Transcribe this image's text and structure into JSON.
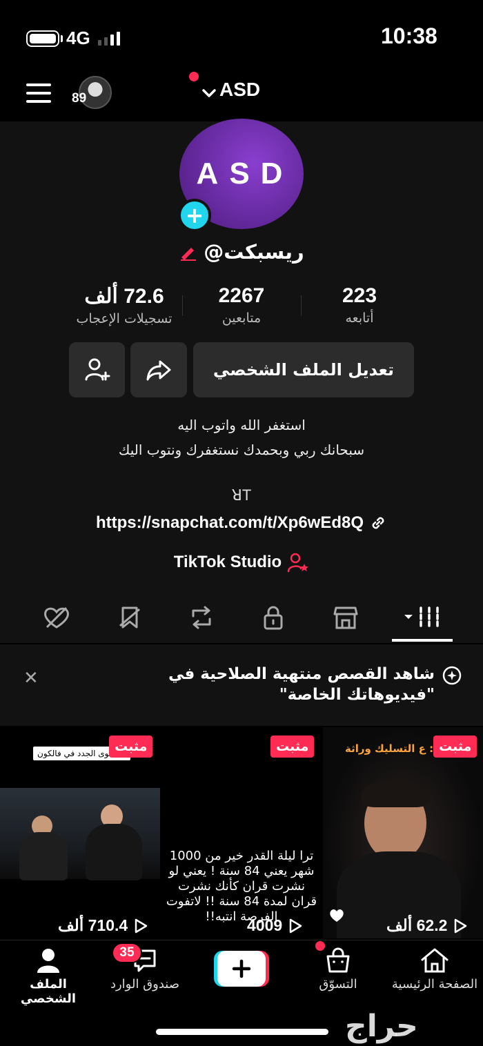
{
  "status_bar": {
    "network": "4G",
    "time": "10:38"
  },
  "header": {
    "story_count": "89",
    "account_name": "ASD"
  },
  "profile": {
    "avatar_text": "ASD",
    "username": "@ريسبكت",
    "stats": [
      {
        "value": "72.6 ألف",
        "label": "تسجيلات الإعجاب"
      },
      {
        "value": "2267",
        "label": "متابعين"
      },
      {
        "value": "223",
        "label": "أتابعه"
      }
    ],
    "edit_profile_label": "تعديل الملف الشخصي",
    "bio_lines": [
      "استغفر الله واتوب اليه",
      "سبحانك ربي وبحمدك نستغفرك ونتوب اليك"
    ],
    "bio_tag": "ꓤT",
    "link": "https://snapchat.com/t/Xp6wEd8Q",
    "studio_label": "TikTok Studio"
  },
  "banner": {
    "text_line1": "شاهد القصص منتهية الصلاحية في",
    "text_line2": "\"فيديوهاتك الخاصة\""
  },
  "videos": [
    {
      "pinned_label": "مثبت",
      "views": "710.4 ألف",
      "caption": "المحتوى الجدد في فالكون"
    },
    {
      "pinned_label": "مثبت",
      "views": "4009",
      "overlay": "ترا ليلة القدر خير من 1000 شهر يعني 84 سنة ! يعني لو نشرت قران كأنك نشرت قران لمدة 84 سنة !! لاتفوت الفرصة انتبه!!"
    },
    {
      "pinned_label": "مثبت",
      "views": "62.2 ألف",
      "caption": "ع التسليك وراثة :"
    }
  ],
  "bottom_nav": {
    "profile": "الملف الشخصي",
    "inbox": "صندوق الوارد",
    "inbox_badge": "35",
    "shop": "التسوّق",
    "home": "الصفحة الرئيسية"
  },
  "watermark": "حراج",
  "colors": {
    "accent": "#fe2c55",
    "cyan": "#20d5ec",
    "background": "#121212"
  }
}
